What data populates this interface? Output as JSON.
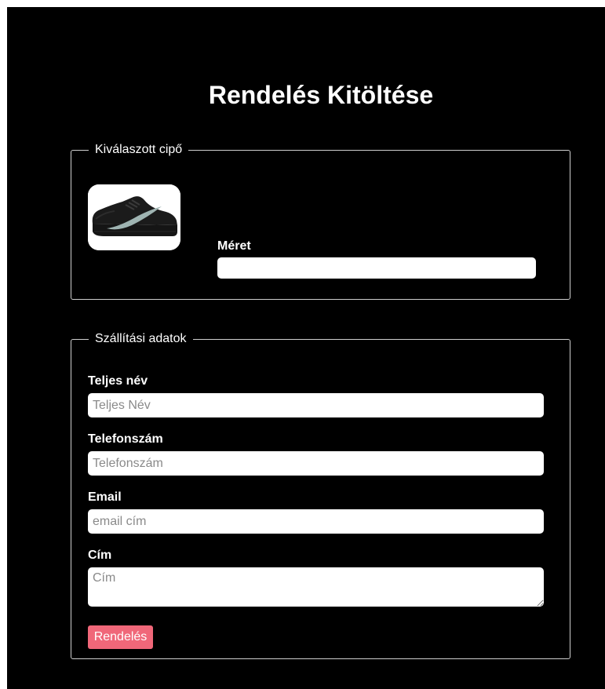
{
  "page": {
    "title": "Rendelés Kitöltése"
  },
  "selected_shoe": {
    "legend": "Kiválaszott cipő",
    "image_icon": "sneaker-image",
    "size_label": "Méret",
    "size_value": ""
  },
  "shipping": {
    "legend": "Szállítási adatok",
    "full_name_label": "Teljes név",
    "full_name_placeholder": "Teljes Név",
    "phone_label": "Telefonszám",
    "phone_placeholder": "Telefonszám",
    "email_label": "Email",
    "email_placeholder": "email cím",
    "address_label": "Cím",
    "address_placeholder": "Cím",
    "submit_label": "Rendelés"
  },
  "colors": {
    "background": "#000000",
    "text": "#ffffff",
    "button": "#f06779",
    "border": "#cfcfcf"
  }
}
